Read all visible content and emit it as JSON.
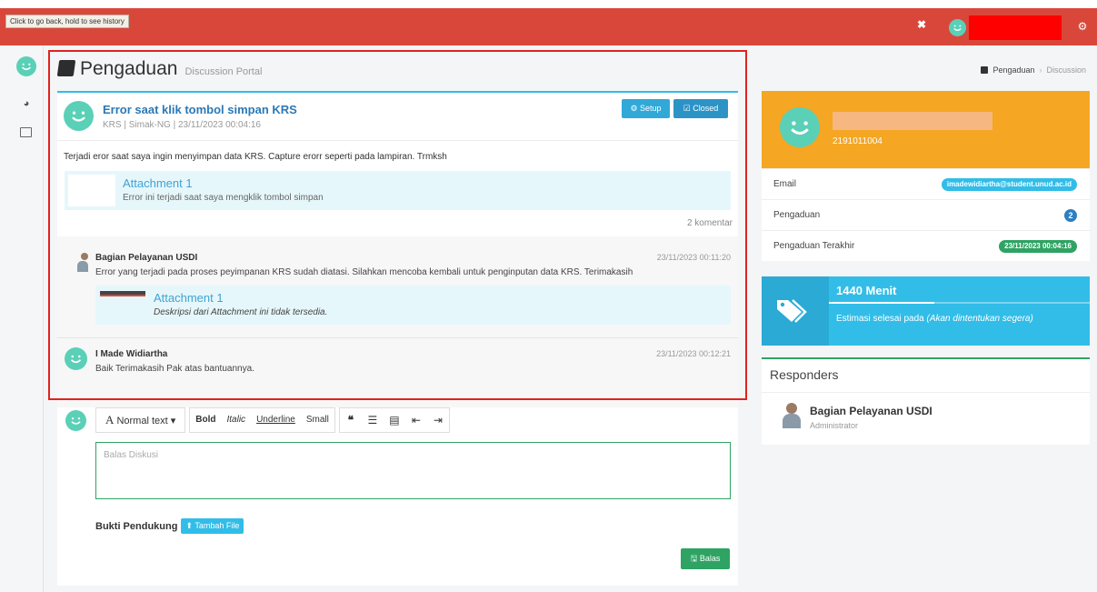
{
  "browser": {
    "back_tooltip": "Click to go back, hold to see history"
  },
  "header": {
    "page_title": "Pengaduan",
    "page_subtitle": "Discussion Portal"
  },
  "breadcrumb": {
    "items": [
      "Pengaduan",
      "Discussion"
    ]
  },
  "thread": {
    "title": "Error saat klik tombol simpan KRS",
    "meta": "KRS | Simak-NG | 23/11/2023 00:04:16",
    "setup_label": "Setup",
    "closed_label": "Closed",
    "body": "Terjadi eror saat saya ingin menyimpan data KRS. Capture erorr seperti pada lampiran. Trmksh",
    "attachment": {
      "title": "Attachment 1",
      "description": "Error ini terjadi saat saya mengklik tombol simpan"
    },
    "comment_count": "2 komentar"
  },
  "comments": [
    {
      "name": "Bagian Pelayanan USDI",
      "time": "23/11/2023 00:11:20",
      "text": "Error yang terjadi pada proses peyimpanan KRS sudah diatasi. Silahkan mencoba kembali untuk penginputan data KRS. Terimakasih",
      "attachment": {
        "title": "Attachment 1",
        "description": "Deskripsi dari Attachment ini tidak tersedia."
      }
    },
    {
      "name": "I Made Widiartha",
      "time": "23/11/2023 00:12:21",
      "text": "Baik Terimakasih Pak atas bantuannya."
    }
  ],
  "editor": {
    "format_label": "Normal text",
    "bold": "Bold",
    "italic": "Italic",
    "underline": "Underline",
    "small": "Small",
    "placeholder": "Balas Diskusi",
    "support_label": "Bukti Pendukung",
    "add_file_label": "Tambah File",
    "reply_label": "Balas"
  },
  "profile": {
    "nim": "2191011004",
    "email_label": "Email",
    "email": "imadewidiartha@student.unud.ac.id",
    "complaints_label": "Pengaduan",
    "complaints_count": "2",
    "last_label": "Pengaduan Terakhir",
    "last_date": "23/11/2023 00:04:16"
  },
  "estimate": {
    "title": "1440 Menit",
    "text_prefix": "Estimasi selesai pada",
    "text_em": "(Akan dintentukan segera)"
  },
  "responders": {
    "title": "Responders",
    "name": "Bagian Pelayanan USDI",
    "role": "Administrator"
  },
  "colors": {
    "topbar": "#d9473b",
    "accent_blue": "#31bde8",
    "accent_green": "#2fa363",
    "accent_orange": "#f5a623",
    "avatar_teal": "#5ad0b7"
  },
  "icons": [
    "expand-icon",
    "settings-icon",
    "dashboard-icon",
    "id-card-icon",
    "book-icon",
    "tag-icon",
    "quote-icon",
    "list-icon"
  ]
}
